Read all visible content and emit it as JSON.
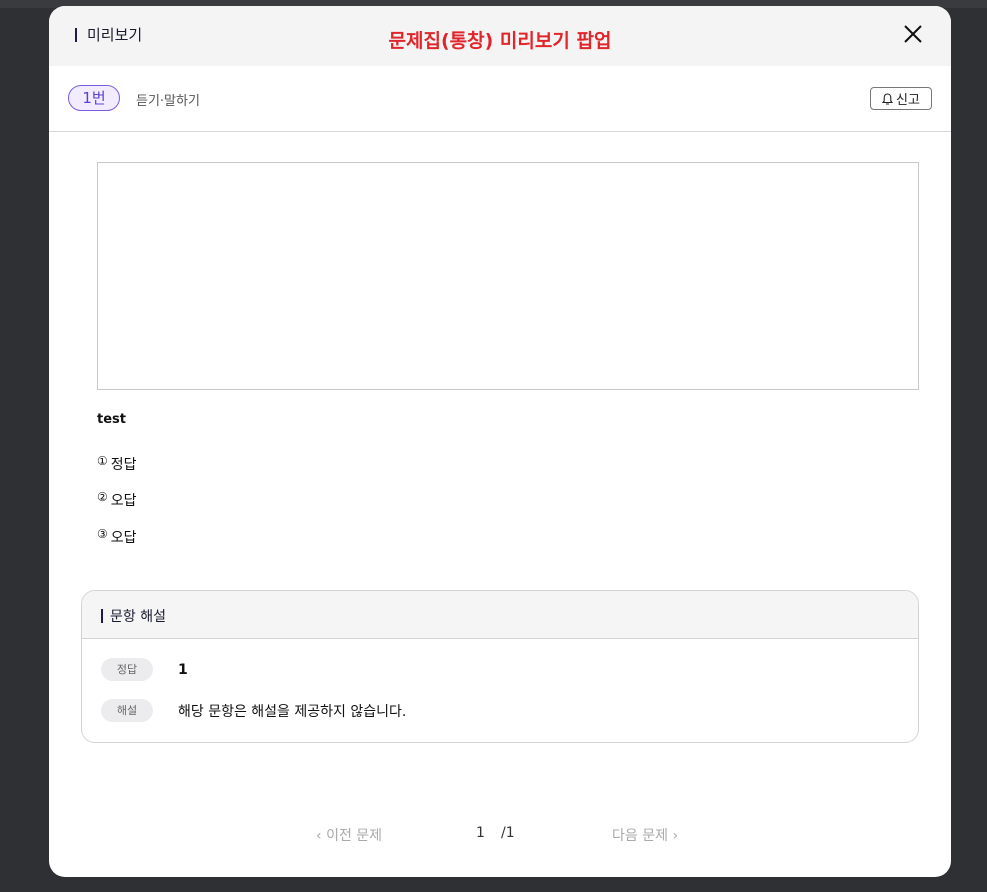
{
  "header": {
    "label": "미리보기",
    "popup_title": "문제집(통창) 미리보기 팝업"
  },
  "question_bar": {
    "number": "1번",
    "category": "듣기·말하기",
    "report_label": "신고"
  },
  "question": {
    "text": "test",
    "choices": [
      {
        "mark": "①",
        "label": "정답"
      },
      {
        "mark": "②",
        "label": "오답"
      },
      {
        "mark": "③",
        "label": "오답"
      }
    ]
  },
  "explanation": {
    "title": "문항 해설",
    "answer_tag": "정답",
    "answer_value": "1",
    "explain_tag": "해설",
    "explain_value": "해당 문항은 해설을 제공하지 않습니다."
  },
  "pager": {
    "prev_label": "이전 문제",
    "current_page": "1",
    "total_pages": "/1",
    "next_label": "다음 문제"
  },
  "colors": {
    "title_red": "#e0262b",
    "accent_purple": "#5b3fd1"
  }
}
